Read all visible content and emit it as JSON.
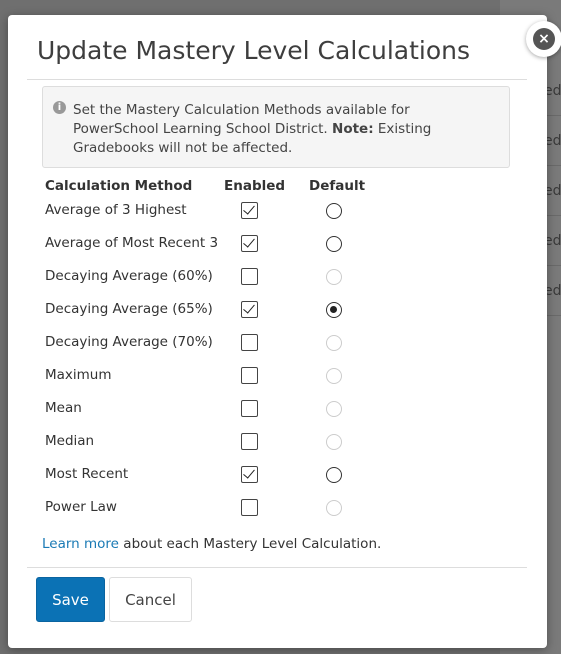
{
  "background": {
    "row_suffix": "ed"
  },
  "modal": {
    "title": "Update Mastery Level Calculations",
    "close_symbol": "×",
    "info": {
      "icon": "info-icon",
      "text": "Set the Mastery Calculation Methods available for PowerSchool Learning School District.",
      "note_label": "Note:",
      "note_text": " Existing Gradebooks will not be affected."
    },
    "columns": {
      "method": "Calculation Method",
      "enabled": "Enabled",
      "default": "Default"
    },
    "methods": [
      {
        "label": "Average of 3 Highest",
        "enabled": true,
        "default": false,
        "default_disabled": false
      },
      {
        "label": "Average of Most Recent 3",
        "enabled": true,
        "default": false,
        "default_disabled": false
      },
      {
        "label": "Decaying Average (60%)",
        "enabled": false,
        "default": false,
        "default_disabled": true
      },
      {
        "label": "Decaying Average (65%)",
        "enabled": true,
        "default": true,
        "default_disabled": false
      },
      {
        "label": "Decaying Average (70%)",
        "enabled": false,
        "default": false,
        "default_disabled": true
      },
      {
        "label": "Maximum",
        "enabled": false,
        "default": false,
        "default_disabled": true
      },
      {
        "label": "Mean",
        "enabled": false,
        "default": false,
        "default_disabled": true
      },
      {
        "label": "Median",
        "enabled": false,
        "default": false,
        "default_disabled": true
      },
      {
        "label": "Most Recent",
        "enabled": true,
        "default": false,
        "default_disabled": false
      },
      {
        "label": "Power Law",
        "enabled": false,
        "default": false,
        "default_disabled": true
      }
    ],
    "learn_more": {
      "link_text": "Learn more",
      "suffix": " about each Mastery Level Calculation."
    },
    "buttons": {
      "save": "Save",
      "cancel": "Cancel"
    }
  }
}
